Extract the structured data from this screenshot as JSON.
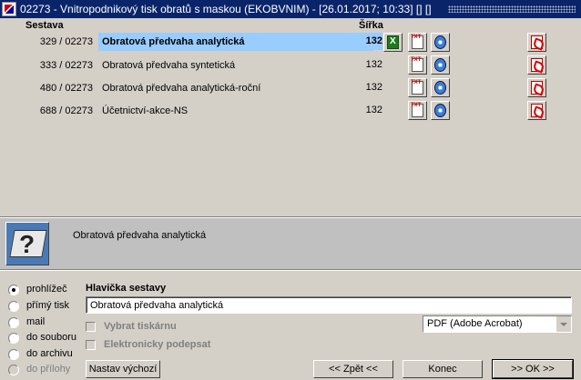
{
  "window": {
    "title": "02273 - Vnitropodnikový tisk obratů s maskou (EKOBVNIM) - [26.01.2017; 10:33] [] []"
  },
  "list": {
    "header_sestava": "Sestava",
    "header_sirka": "Šířka",
    "rows": [
      {
        "num": "329 / 02273",
        "name": "Obratová předvaha analytická",
        "width": "132",
        "selected": true
      },
      {
        "num": "333 / 02273",
        "name": "Obratová předvaha syntetická",
        "width": "132"
      },
      {
        "num": "480 / 02273",
        "name": "Obratová předvaha analytická-roční",
        "width": "132"
      },
      {
        "num": "688 / 02273",
        "name": "Účetnictví-akce-NS",
        "width": "132"
      }
    ]
  },
  "info": {
    "selected_report": "Obratová předvaha analytická"
  },
  "output": {
    "options": [
      "prohlížeč",
      "přímý tisk",
      "mail",
      "do souboru",
      "do archivu",
      "do přílohy"
    ],
    "selected": "prohlížeč"
  },
  "header_section": {
    "label": "Hlavička sestavy",
    "value": "Obratová předvaha analytická"
  },
  "options": {
    "vybrat_tiskarnu": "Vybrat tiskárnu",
    "elektronicky_podepsat": "Elektronicky podepsat",
    "printer_selected": "PDF (Adobe Acrobat)"
  },
  "buttons": {
    "nastav_vychozi": "Nastav výchozí",
    "zpet": "<< Zpět <<",
    "konec": "Konec",
    "ok": ">> OK >>"
  },
  "colors": {
    "titlebar": "#0a246a",
    "selection": "#99ccff",
    "face": "#d4d0c8"
  }
}
